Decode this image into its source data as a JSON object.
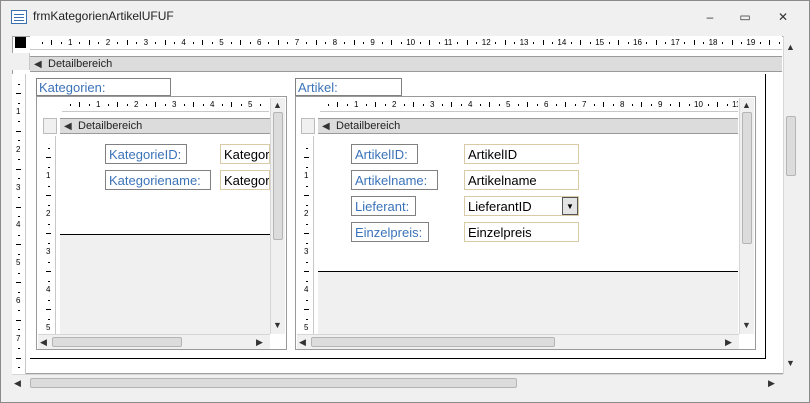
{
  "window": {
    "title": "frmKategorienArtikelUFUF",
    "minimize": "–",
    "restore": "▭",
    "close": "✕"
  },
  "main": {
    "ruler_numbers": [
      "1",
      "2",
      "3",
      "4",
      "5",
      "6",
      "7",
      "8",
      "9",
      "10",
      "11",
      "12",
      "13",
      "14",
      "15",
      "16",
      "17",
      "18",
      "19"
    ],
    "vruler_numbers": [
      "1",
      "2",
      "3",
      "4",
      "5",
      "6",
      "7"
    ],
    "section_label": "Detailbereich"
  },
  "kategorien": {
    "caption": "Kategorien:",
    "ruler_numbers": [
      "1",
      "2",
      "3",
      "4",
      "5"
    ],
    "vruler_numbers": [
      "1",
      "2",
      "3",
      "4",
      "5"
    ],
    "section_label": "Detailbereich",
    "fields": [
      {
        "label": "KategorieID:",
        "value": "Kategor"
      },
      {
        "label": "Kategoriename:",
        "value": "Kategor"
      }
    ]
  },
  "artikel": {
    "caption": "Artikel:",
    "ruler_numbers": [
      "1",
      "2",
      "3",
      "4",
      "5",
      "6",
      "7",
      "8",
      "9",
      "10",
      "11"
    ],
    "vruler_numbers": [
      "1",
      "2",
      "3",
      "4",
      "5"
    ],
    "section_label": "Detailbereich",
    "fields": [
      {
        "label": "ArtikelID:",
        "value": "ArtikelID"
      },
      {
        "label": "Artikelname:",
        "value": "Artikelname"
      },
      {
        "label": "Lieferant:",
        "value": "LieferantID"
      },
      {
        "label": "Einzelpreis:",
        "value": "Einzelpreis"
      }
    ]
  },
  "icons": {
    "section_toggle": "section-toggle-icon",
    "dropdown": "dropdown-arrow-icon"
  }
}
